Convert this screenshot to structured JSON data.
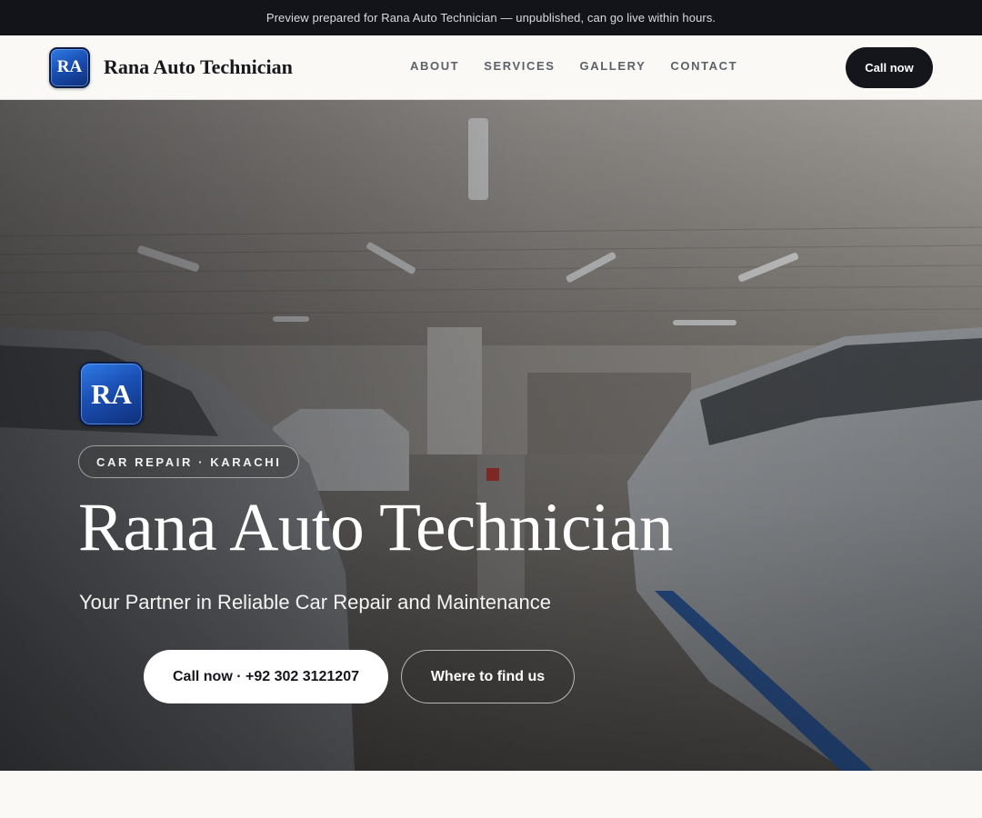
{
  "preview_banner": {
    "text": "Preview prepared for Rana Auto Technician — unpublished, can go live within hours."
  },
  "header": {
    "logo_text": "RA",
    "brand_name": "Rana Auto Technician",
    "nav": [
      {
        "label": "ABOUT"
      },
      {
        "label": "SERVICES"
      },
      {
        "label": "GALLERY"
      },
      {
        "label": "CONTACT"
      }
    ],
    "call_label": "Call now"
  },
  "hero": {
    "logo_text": "RA",
    "tag": "CAR REPAIR · KARACHI",
    "title": "Rana Auto Technician",
    "subtitle": "Your Partner in Reliable Car Repair and Maintenance",
    "primary_button": "Call now · +92 302 3121207",
    "secondary_button": "Where to find us",
    "background": "car-workshop-photo"
  },
  "colors": {
    "dark": "#12141a",
    "accent_blue": "#1a4fb3",
    "page_bg": "#faf9f6"
  }
}
